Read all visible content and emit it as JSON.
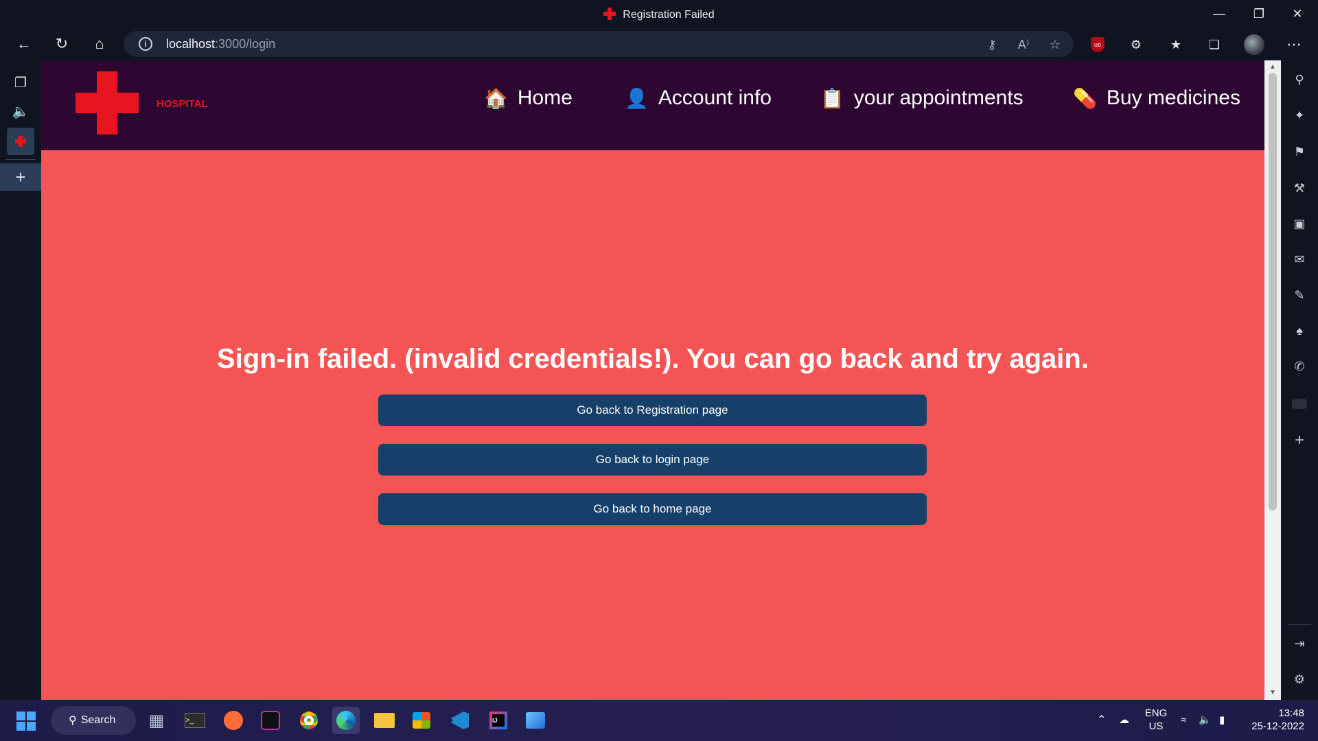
{
  "window": {
    "title": "Registration Failed",
    "controls": [
      "minimize-icon",
      "restore-icon",
      "close-icon"
    ]
  },
  "toolbar": {
    "url_host": "localhost",
    "url_path": ":3000/login",
    "buttons": [
      "back-icon",
      "refresh-icon",
      "home-icon"
    ],
    "address_icons": [
      "password-key-icon",
      "read-aloud-icon",
      "add-favorite-icon"
    ],
    "extensions": [
      "ublock-icon",
      "extensions-icon",
      "favorites-icon",
      "collections-icon",
      "profile-avatar",
      "more-icon"
    ]
  },
  "left_sidebar": [
    "tab-actions-icon",
    "audio-icon",
    "active-tab-hospital-icon",
    "new-tab-icon"
  ],
  "right_sidebar": [
    "search-icon",
    "copilot-icon",
    "shopping-icon",
    "tools-icon",
    "office-icon",
    "outlook-icon",
    "drop-icon",
    "games-icon",
    "whatsapp-icon",
    "youtube-icon",
    "add-icon",
    "split-icon",
    "settings-icon"
  ],
  "site": {
    "brand": "HOSPITAL",
    "nav": [
      {
        "icon": "🏠",
        "label": "Home"
      },
      {
        "icon": "👤",
        "label": "Account info"
      },
      {
        "icon": "📋",
        "label": "your appointments"
      },
      {
        "icon": "💊",
        "label": "Buy medicines"
      }
    ],
    "message": "Sign-in failed. (invalid credentials!). You can go back and try again.",
    "buttons": [
      "Go back to Registration page",
      "Go back to login page",
      "Go back to home page"
    ],
    "colors": {
      "background": "#f55454",
      "navbar": "#2d0632",
      "button": "#163f6a",
      "brand": "#e8141f"
    }
  },
  "taskbar": {
    "search_label": "Search",
    "lang_top": "ENG",
    "lang_bottom": "US",
    "time": "13:48",
    "date": "25-12-2022"
  }
}
